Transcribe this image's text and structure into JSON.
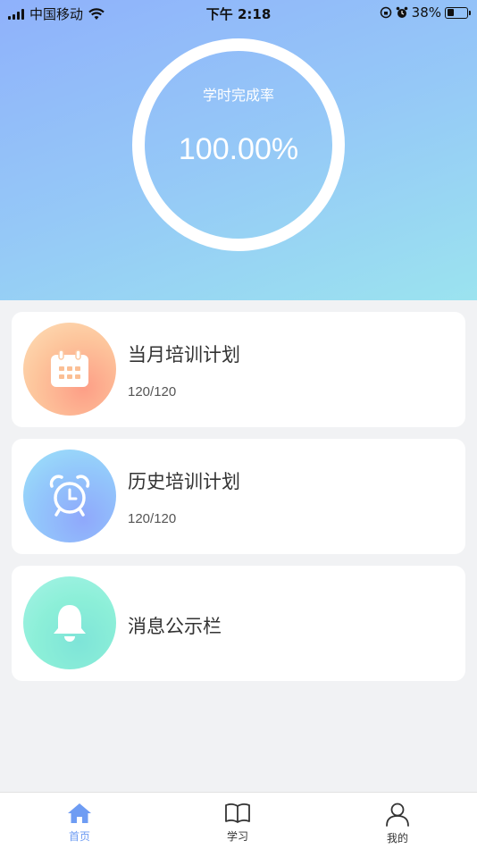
{
  "status_bar": {
    "carrier": "中国移动",
    "time": "下午 2:18",
    "battery_percent": "38%",
    "battery_level": 0.38
  },
  "progress": {
    "label": "学时完成率",
    "value": "100.00%"
  },
  "cards": [
    {
      "title": "当月培训计划",
      "count": "120/120",
      "icon": "calendar-icon"
    },
    {
      "title": "历史培训计划",
      "count": "120/120",
      "icon": "alarm-clock-icon"
    },
    {
      "title": "消息公示栏",
      "icon": "bell-icon"
    }
  ],
  "tabbar": {
    "items": [
      {
        "label": "首页",
        "icon": "home-icon",
        "active": true
      },
      {
        "label": "学习",
        "icon": "book-icon",
        "active": false
      },
      {
        "label": "我的",
        "icon": "person-icon",
        "active": false
      }
    ],
    "active_color": "#6e9cf3"
  }
}
